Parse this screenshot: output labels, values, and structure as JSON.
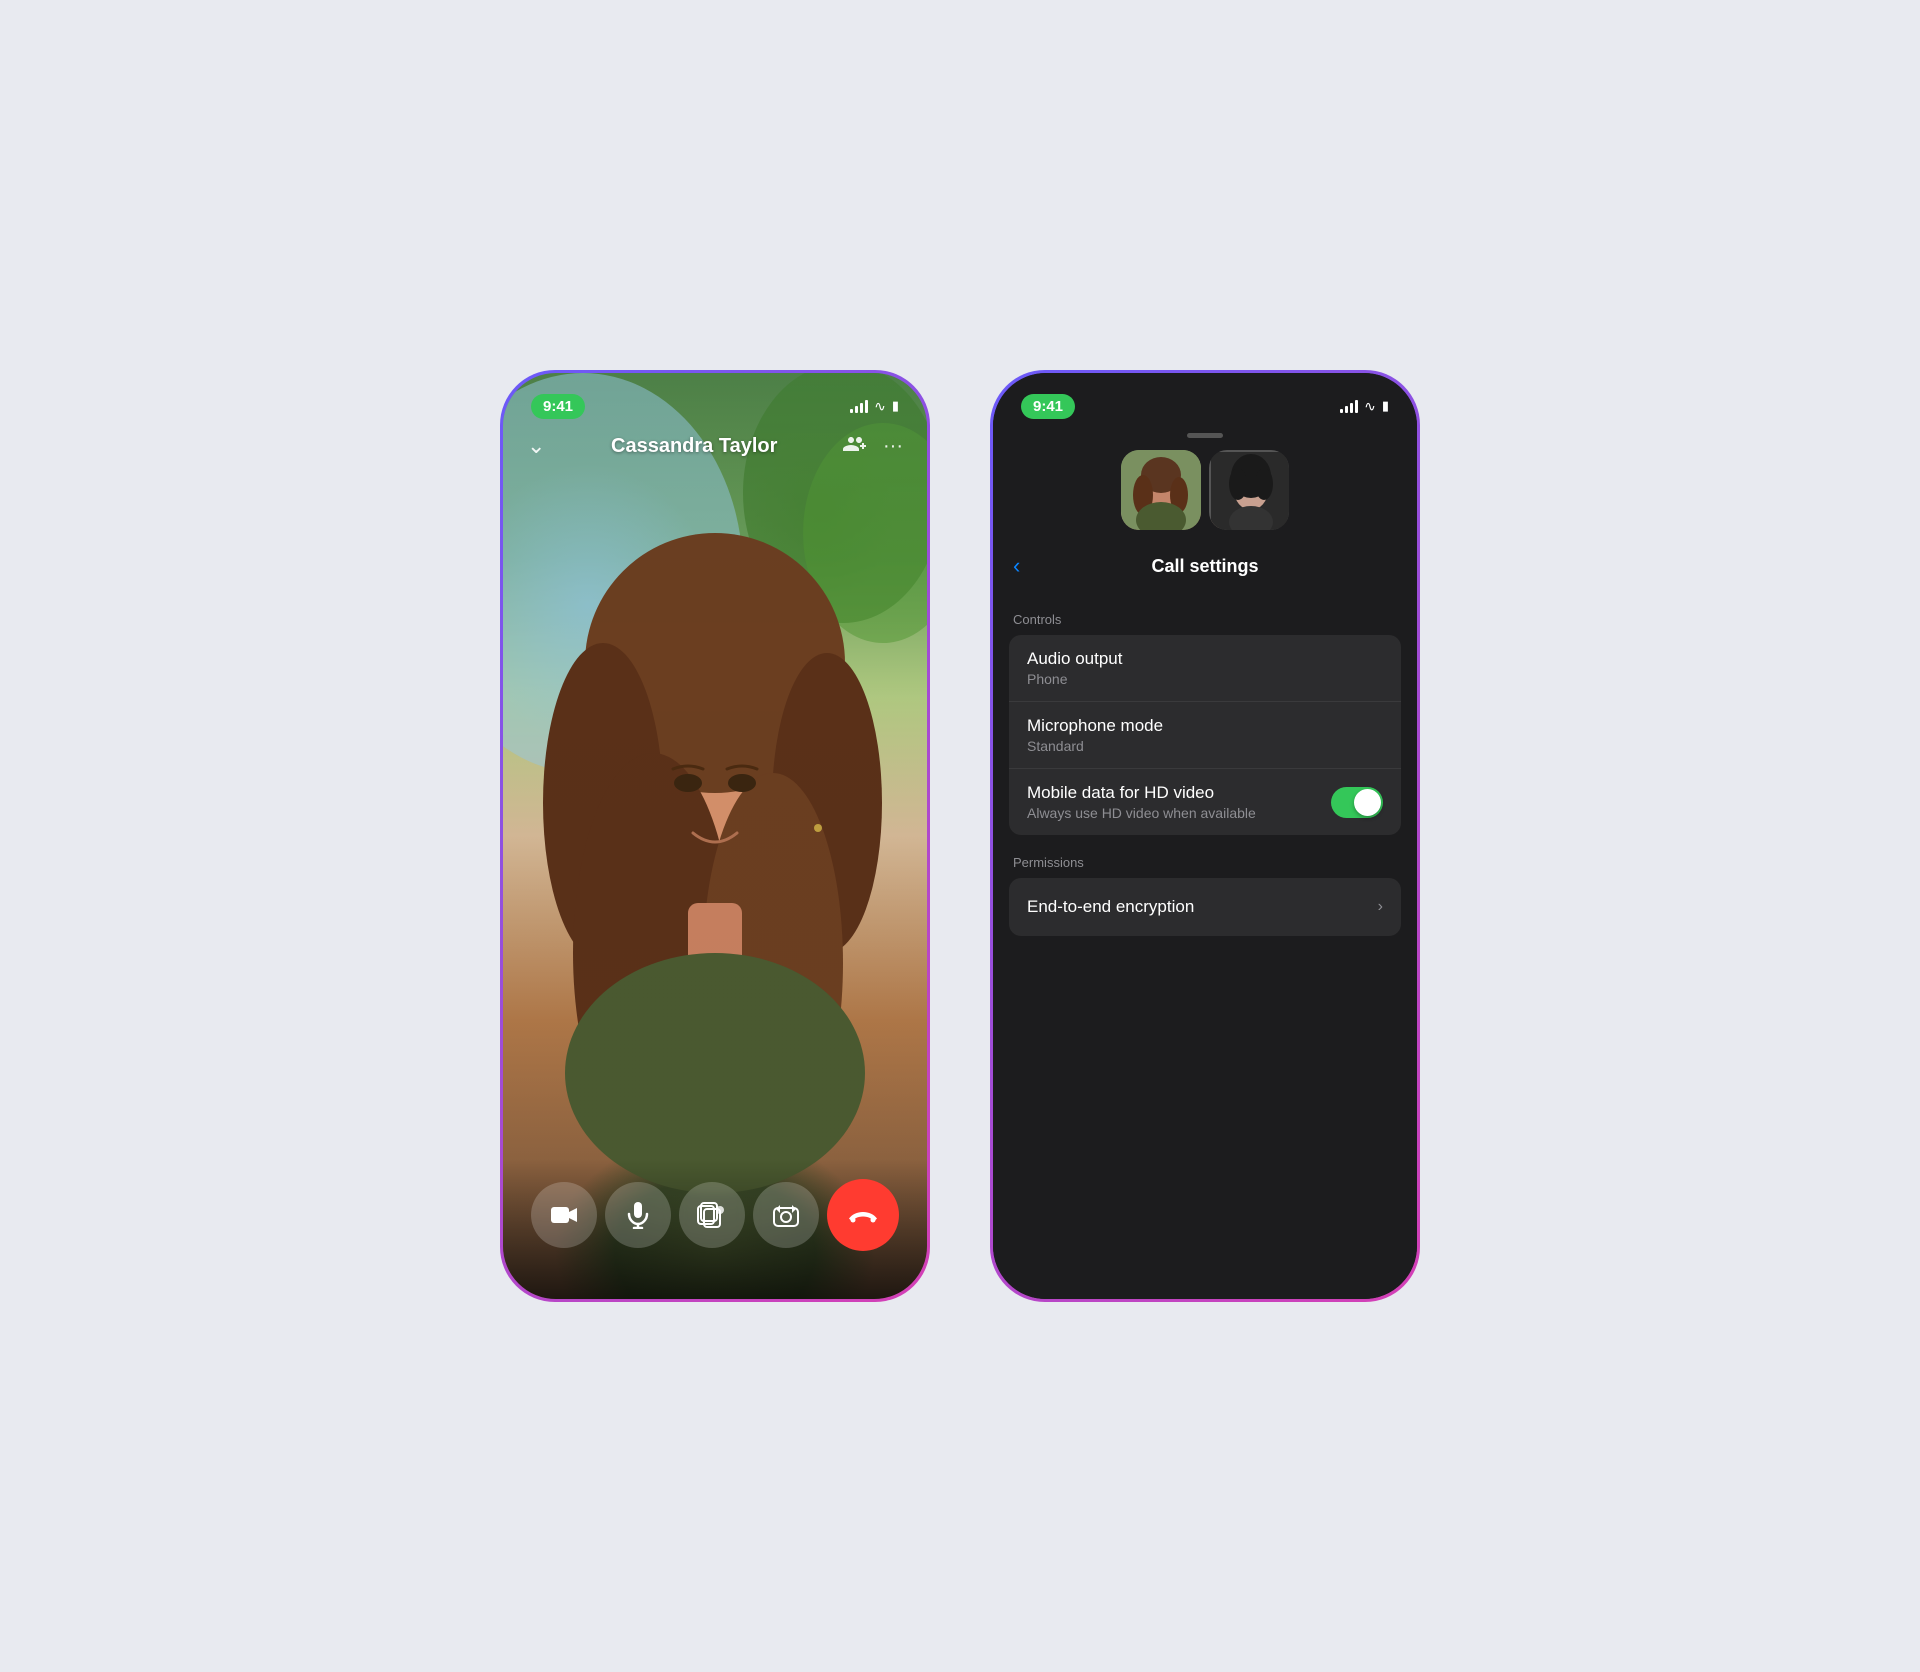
{
  "left_phone": {
    "status_bar": {
      "time": "9:41",
      "signal": "signal",
      "wifi": "wifi",
      "battery": "battery"
    },
    "call_header": {
      "chevron": "‹",
      "caller_name": "Cassandra Taylor",
      "add_person_icon": "add-person",
      "more_icon": "more"
    },
    "controls": {
      "video_icon": "video",
      "mic_icon": "mic",
      "effects_icon": "effects",
      "flip_icon": "flip",
      "end_call_icon": "end-call"
    }
  },
  "right_phone": {
    "status_bar": {
      "time": "9:41",
      "signal": "signal",
      "wifi": "wifi",
      "battery": "battery"
    },
    "drag_handle": true,
    "nav": {
      "back_label": "‹",
      "title": "Call settings"
    },
    "sections": {
      "controls_label": "Controls",
      "audio_output": {
        "title": "Audio output",
        "subtitle": "Phone"
      },
      "microphone_mode": {
        "title": "Microphone mode",
        "subtitle": "Standard"
      },
      "mobile_data": {
        "title": "Mobile data for HD video",
        "subtitle": "Always use HD video when available",
        "toggle": true
      },
      "permissions_label": "Permissions",
      "end_to_end": {
        "title": "End-to-end encryption"
      }
    }
  }
}
